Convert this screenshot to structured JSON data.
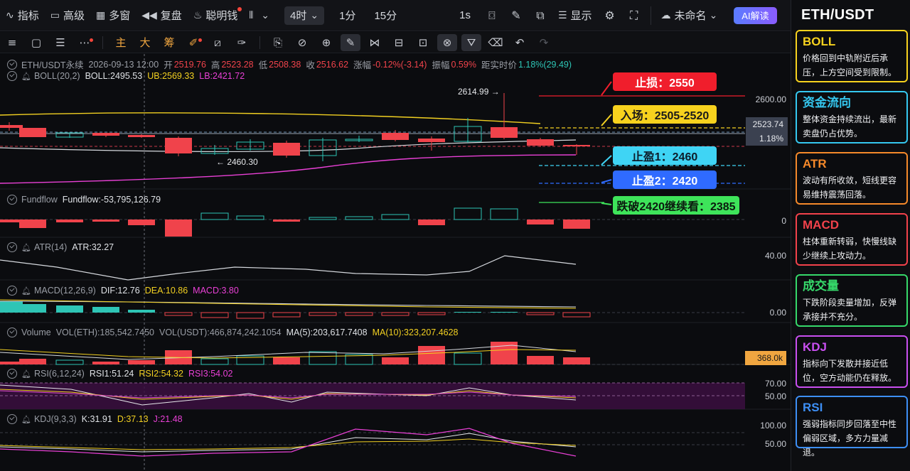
{
  "toolbar": {
    "items": [
      {
        "icon": "indicator-icon",
        "glyph": "∿",
        "label": "指标"
      },
      {
        "icon": "template-icon",
        "glyph": "▭",
        "label": "高级"
      },
      {
        "icon": "multi-window-icon",
        "glyph": "▦",
        "label": "多窗"
      },
      {
        "icon": "replay-icon",
        "glyph": "◀◀",
        "label": "复盘"
      },
      {
        "icon": "smart-money-icon",
        "glyph": "♨",
        "label": "聪明钱"
      }
    ],
    "chart_type_glyph": "⫴",
    "chart_type_caret": "⌄",
    "active_interval": "4时",
    "active_interval_caret": "⌄",
    "intervals": [
      "1分",
      "15分"
    ],
    "right_interval": "1s",
    "display_label": "显示",
    "layout_name": "未命名",
    "layout_caret": "⌄",
    "ai_label": "AI解读"
  },
  "drawbar": {
    "text_tools": [
      "主",
      "大",
      "筹"
    ]
  },
  "legend": {
    "main": {
      "symbol": "ETH/USDT永续",
      "time": "2026-09-13 12:00",
      "open_lbl": "开",
      "open": "2519.76",
      "high_lbl": "高",
      "high": "2523.28",
      "low_lbl": "低",
      "low": "2508.38",
      "close_lbl": "收",
      "close": "2516.62",
      "chg_lbl": "涨幅",
      "chg": "-0.12%(-3.14)",
      "amp_lbl": "振幅",
      "amp": "0.59%",
      "dist_lbl": "距实时价",
      "dist": "1.18%(29.49)"
    },
    "boll": {
      "name": "BOLL(20,2)",
      "mid": "BOLL:2495.53",
      "ub": "UB:2569.33",
      "lb": "LB:2421.72"
    },
    "fundflow": {
      "name": "Fundflow",
      "value": "Fundflow:-53,795,126.79"
    },
    "atr": {
      "name": "ATR(14)",
      "value": "ATR:32.27"
    },
    "macd": {
      "name": "MACD(12,26,9)",
      "dif": "DIF:12.76",
      "dea": "DEA:10.86",
      "macd": "MACD:3.80"
    },
    "volume": {
      "name": "Volume",
      "eth": "VOL(ETH):185,542.7450",
      "usdt": "VOL(USDT):466,874,242.1054",
      "ma5": "MA(5):203,617.7408",
      "ma10": "MA(10):323,207.4628"
    },
    "rsi": {
      "name": "RSI(6,12,24)",
      "r1": "RSI1:51.24",
      "r2": "RSI2:54.32",
      "r3": "RSI3:54.02"
    },
    "kdj": {
      "name": "KDJ(9,3,3)",
      "k": "K:31.91",
      "d": "D:37.13",
      "j": "J:21.48"
    }
  },
  "axis": {
    "main_top": "2600.00",
    "current_price": "2523.74",
    "current_pct": "1.18%",
    "fundflow_zero": "0",
    "atr": "40.00",
    "macd_zero": "0.00",
    "volume_tag": "368.0k",
    "rsi_70": "70.00",
    "rsi_50": "50.00",
    "kdj_100": "100.00",
    "kdj_50": "50.00"
  },
  "annotations": {
    "high_marker": "2614.99 →",
    "low_marker": "← 2460.30"
  },
  "callouts": {
    "stop_loss": "止损：2550",
    "entry": "入场：2505-2520",
    "tp1": "止盈1：2460",
    "tp2": "止盈2：2420",
    "break": "跌破2420继续看：2385"
  },
  "colors": {
    "up": "#2ec5b5",
    "down": "#f0434b",
    "yellow": "#f2d021",
    "magenta": "#e940d6",
    "cyan": "#3fd4f4",
    "blue": "#2f6bff",
    "green": "#3ee45a"
  },
  "sidebar": {
    "title": "ETH/USDT",
    "cards": [
      {
        "title": "BOLL",
        "body": "价格回到中轨附近后承压，上方空间受到限制。",
        "color": "#f7d21e"
      },
      {
        "title": "资金流向",
        "body": "整体资金持续流出，最新卖盘仍占优势。",
        "color": "#35c8f0"
      },
      {
        "title": "ATR",
        "body": "波动有所收敛，短线更容易维持震荡回落。",
        "color": "#f5892a"
      },
      {
        "title": "MACD",
        "body": "柱体重新转弱，快慢线缺少继续上攻动力。",
        "color": "#f2424b"
      },
      {
        "title": "成交量",
        "body": "下跌阶段卖量增加，反弹承接并不充分。",
        "color": "#36d96a"
      },
      {
        "title": "KDJ",
        "body": "指标向下发散并接近低位，空方动能仍在释放。",
        "color": "#c94ff0"
      },
      {
        "title": "RSI",
        "body": "强弱指标同步回落至中性偏弱区域，多方力量减退。",
        "color": "#3d8ff5"
      }
    ]
  }
}
